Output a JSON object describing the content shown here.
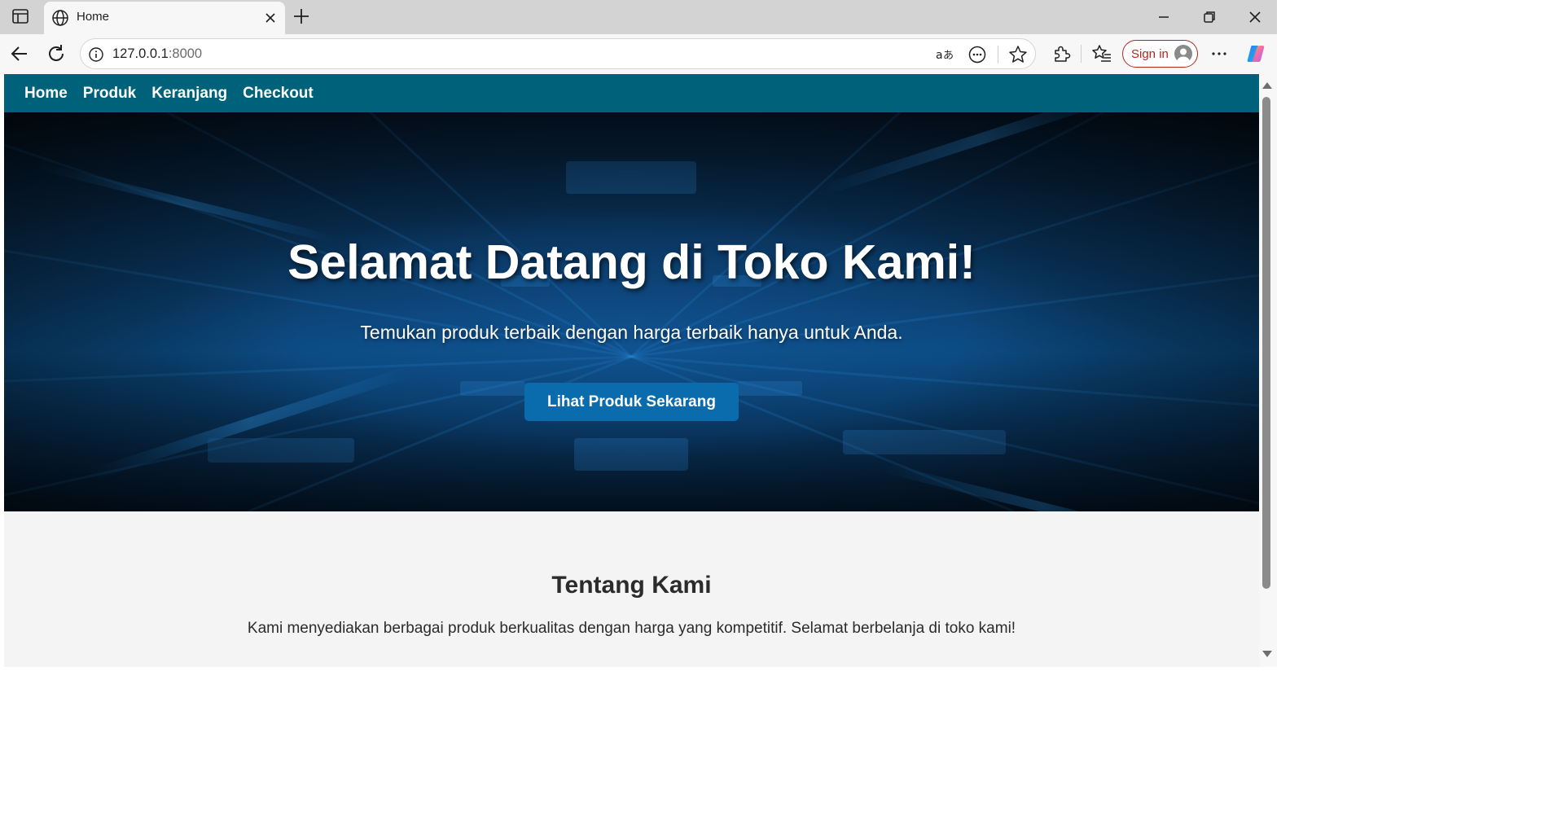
{
  "browser": {
    "tab_title": "Home",
    "url_host": "127.0.0.1",
    "url_port": ":8000",
    "signin_label": "Sign in",
    "icons": [
      "sidebar-icon",
      "globe-icon",
      "close-icon",
      "plus-icon",
      "minimize-icon",
      "restore-icon",
      "window-close-icon",
      "back-icon",
      "refresh-icon",
      "info-icon",
      "read-aloud-icon",
      "more-tools-icon",
      "star-icon",
      "extensions-icon",
      "favorites-icon",
      "profile-icon",
      "more-icon",
      "copilot-icon"
    ]
  },
  "nav": {
    "items": [
      {
        "label": "Home"
      },
      {
        "label": "Produk"
      },
      {
        "label": "Keranjang"
      },
      {
        "label": "Checkout"
      }
    ]
  },
  "hero": {
    "title": "Selamat Datang di Toko Kami!",
    "subtitle": "Temukan produk terbaik dengan harga terbaik hanya untuk Anda.",
    "cta_label": "Lihat Produk Sekarang"
  },
  "about": {
    "title": "Tentang Kami",
    "text": "Kami menyediakan berbagai produk berkualitas dengan harga yang kompetitif. Selamat berbelanja di toko kami!"
  },
  "colors": {
    "nav_bg": "#00627a",
    "cta_bg": "#0a6bad",
    "page_bg": "#f4f4f4",
    "signin_accent": "#b3261e"
  }
}
